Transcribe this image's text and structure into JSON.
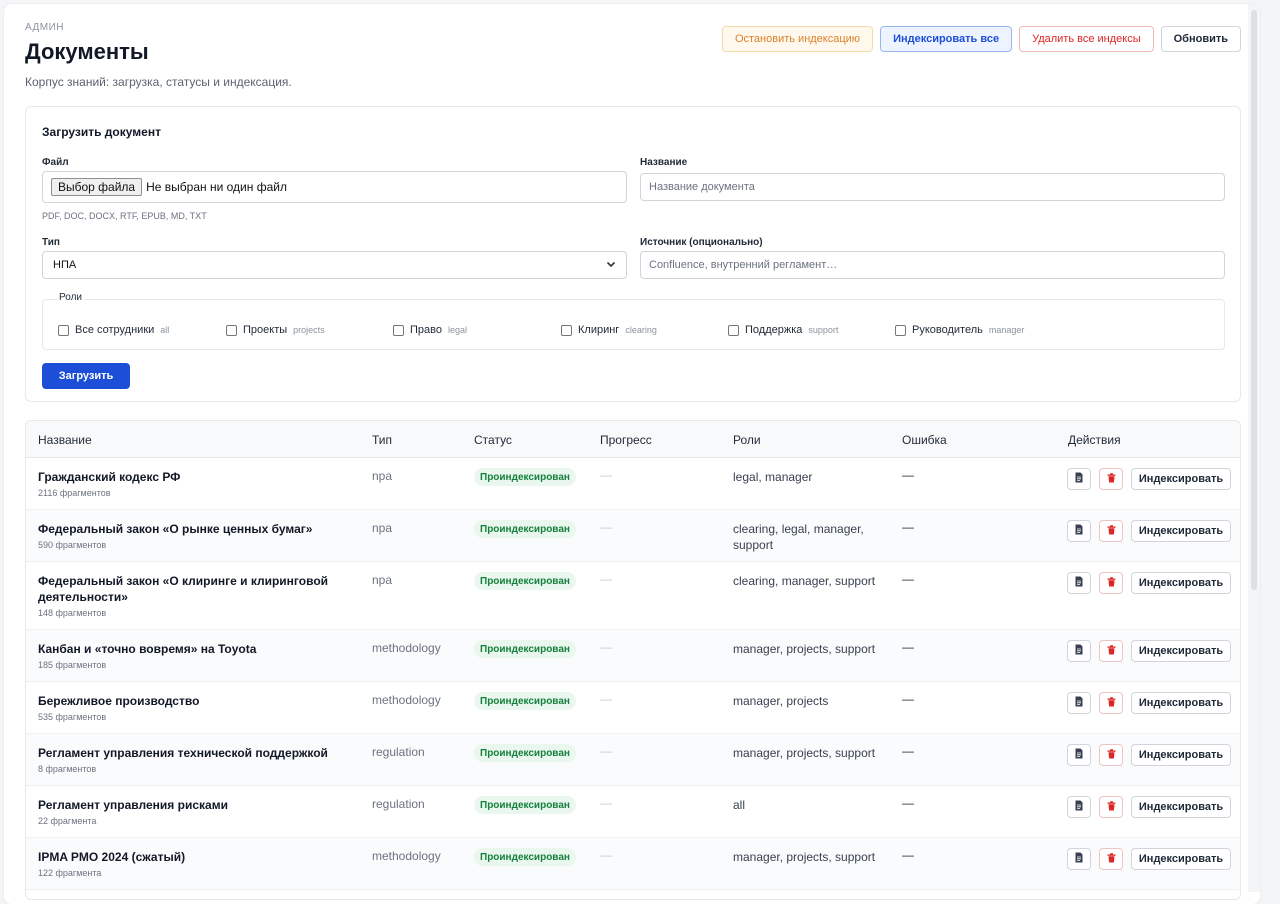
{
  "header": {
    "eyebrow": "АДМИН",
    "title": "Документы",
    "subtitle": "Корпус знаний: загрузка, статусы и индексация.",
    "actions": {
      "stop": "Остановить индексацию",
      "index_all": "Индексировать все",
      "delete_all": "Удалить все индексы",
      "refresh": "Обновить"
    }
  },
  "upload": {
    "title": "Загрузить документ",
    "file_label": "Файл",
    "file_button": "Выбор файла",
    "file_none": "Не выбран ни один файл",
    "file_hint": "PDF, DOC, DOCX, RTF, EPUB, MD, TXT",
    "name_label": "Название",
    "name_placeholder": "Название документа",
    "type_label": "Тип",
    "type_value": "НПА",
    "source_label": "Источник (опционально)",
    "source_placeholder": "Confluence, внутренний регламент…",
    "roles_legend": "Роли",
    "roles": [
      {
        "label": "Все сотрудники",
        "code": "all"
      },
      {
        "label": "Проекты",
        "code": "projects"
      },
      {
        "label": "Право",
        "code": "legal"
      },
      {
        "label": "Клиринг",
        "code": "clearing"
      },
      {
        "label": "Поддержка",
        "code": "support"
      },
      {
        "label": "Руководитель",
        "code": "manager"
      }
    ],
    "submit": "Загрузить"
  },
  "table": {
    "columns": {
      "name": "Название",
      "type": "Тип",
      "status": "Статус",
      "progress": "Прогресс",
      "roles": "Роли",
      "error": "Ошибка",
      "actions": "Действия"
    },
    "index_button": "Индексировать",
    "rows": [
      {
        "name": "Гражданский кодекс РФ",
        "count": "2116 фрагментов",
        "type": "npa",
        "status": "Проиндексирован",
        "progress": "—",
        "roles": "legal, manager",
        "error": "—"
      },
      {
        "name": "Федеральный закон «О рынке ценных бумаг»",
        "count": "590 фрагментов",
        "type": "npa",
        "status": "Проиндексирован",
        "progress": "—",
        "roles": "clearing, legal, manager, support",
        "error": "—"
      },
      {
        "name": "Федеральный закон «О клиринге и клиринговой деятельности»",
        "count": "148 фрагментов",
        "type": "npa",
        "status": "Проиндексирован",
        "progress": "—",
        "roles": "clearing, manager, support",
        "error": "—"
      },
      {
        "name": "Канбан и «точно вовремя» на Toyota",
        "count": "185 фрагментов",
        "type": "methodology",
        "status": "Проиндексирован",
        "progress": "—",
        "roles": "manager, projects, support",
        "error": "—"
      },
      {
        "name": "Бережливое производство",
        "count": "535 фрагментов",
        "type": "methodology",
        "status": "Проиндексирован",
        "progress": "—",
        "roles": "manager, projects",
        "error": "—"
      },
      {
        "name": "Регламент управления технической поддержкой",
        "count": "8 фрагментов",
        "type": "regulation",
        "status": "Проиндексирован",
        "progress": "—",
        "roles": "manager, projects, support",
        "error": "—"
      },
      {
        "name": "Регламент управления рисками",
        "count": "22 фрагмента",
        "type": "regulation",
        "status": "Проиндексирован",
        "progress": "—",
        "roles": "all",
        "error": "—"
      },
      {
        "name": "IPMA PMO 2024 (сжатый)",
        "count": "122 фрагмента",
        "type": "methodology",
        "status": "Проиндексирован",
        "progress": "—",
        "roles": "manager, projects, support",
        "error": "—"
      }
    ]
  },
  "icons": {
    "document": "document-icon",
    "trash": "trash-icon",
    "chevron": "chevron-down-icon"
  },
  "colors": {
    "primary": "#1d4ed8",
    "success": "#15803d",
    "warning": "#d9822b",
    "danger": "#dc2626"
  }
}
